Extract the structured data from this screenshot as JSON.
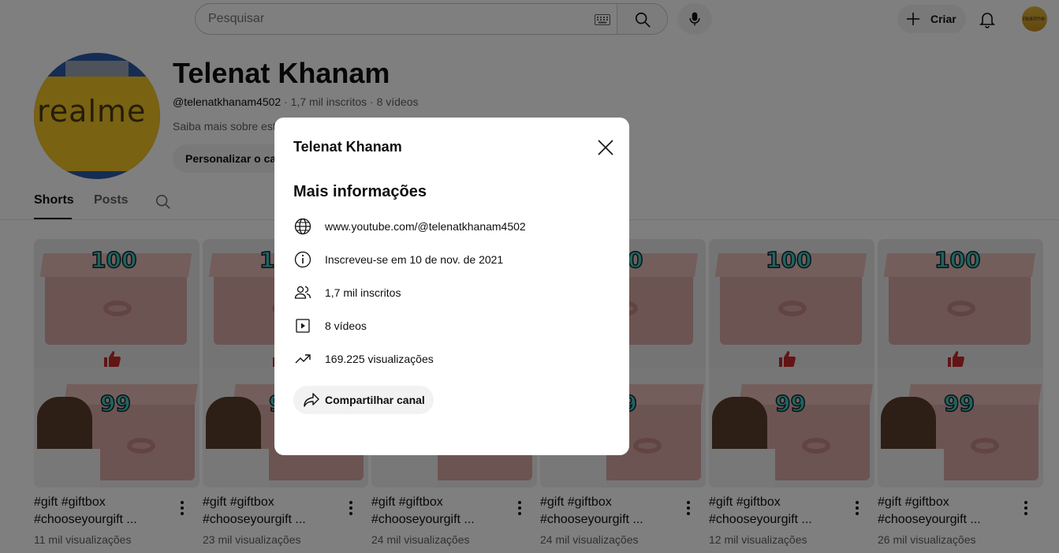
{
  "topbar": {
    "search_placeholder": "Pesquisar",
    "create_label": "Criar",
    "icons": [
      "keyboard-icon",
      "search-icon",
      "mic-icon",
      "plus-icon",
      "bell-icon"
    ]
  },
  "channel": {
    "avatar_text": "realme",
    "avatar_small_text": "realme",
    "name": "Telenat Khanam",
    "handle": "@telenatkhanam4502",
    "subscribers": "1,7 mil inscritos",
    "videos": "8 vídeos",
    "separator": "·",
    "about_text": "Saiba mais sobre este",
    "customize_label": "Personalizar o canal"
  },
  "tabs": [
    {
      "label": "Shorts",
      "active": true
    },
    {
      "label": "Posts",
      "active": false
    }
  ],
  "shorts": [
    {
      "title_line1": "#gift #giftbox",
      "title_line2": "#chooseyourgift ...",
      "views": "11 mil visualizações"
    },
    {
      "title_line1": "#gift #giftbox",
      "title_line2": "#chooseyourgift ...",
      "views": "23 mil visualizações"
    },
    {
      "title_line1": "#gift #giftbox",
      "title_line2": "#chooseyourgift ...",
      "views": "24 mil visualizações"
    },
    {
      "title_line1": "#gift #giftbox",
      "title_line2": "#chooseyourgift ...",
      "views": "24 mil visualizações"
    },
    {
      "title_line1": "#gift #giftbox",
      "title_line2": "#chooseyourgift ...",
      "views": "12 mil visualizações"
    },
    {
      "title_line1": "#gift #giftbox",
      "title_line2": "#chooseyourgift ...",
      "views": "26 mil visualizações"
    }
  ],
  "thumb_text": {
    "top_number": "100",
    "bottom_number": "99"
  },
  "dialog": {
    "title": "Telenat Khanam",
    "heading": "Mais informações",
    "rows": [
      {
        "icon": "globe-icon",
        "text": "www.youtube.com/@telenatkhanam4502"
      },
      {
        "icon": "info-icon",
        "text": "Inscreveu-se em 10 de nov. de 2021"
      },
      {
        "icon": "people-icon",
        "text": "1,7 mil inscritos"
      },
      {
        "icon": "play-icon",
        "text": "8 vídeos"
      },
      {
        "icon": "trending-icon",
        "text": "169.225 visualizações"
      }
    ],
    "share_label": "Compartilhar canal"
  },
  "colors": {
    "overlay": "#000000",
    "accent_teal": "#41c9c1",
    "box_pink": "#d8a9a5"
  }
}
